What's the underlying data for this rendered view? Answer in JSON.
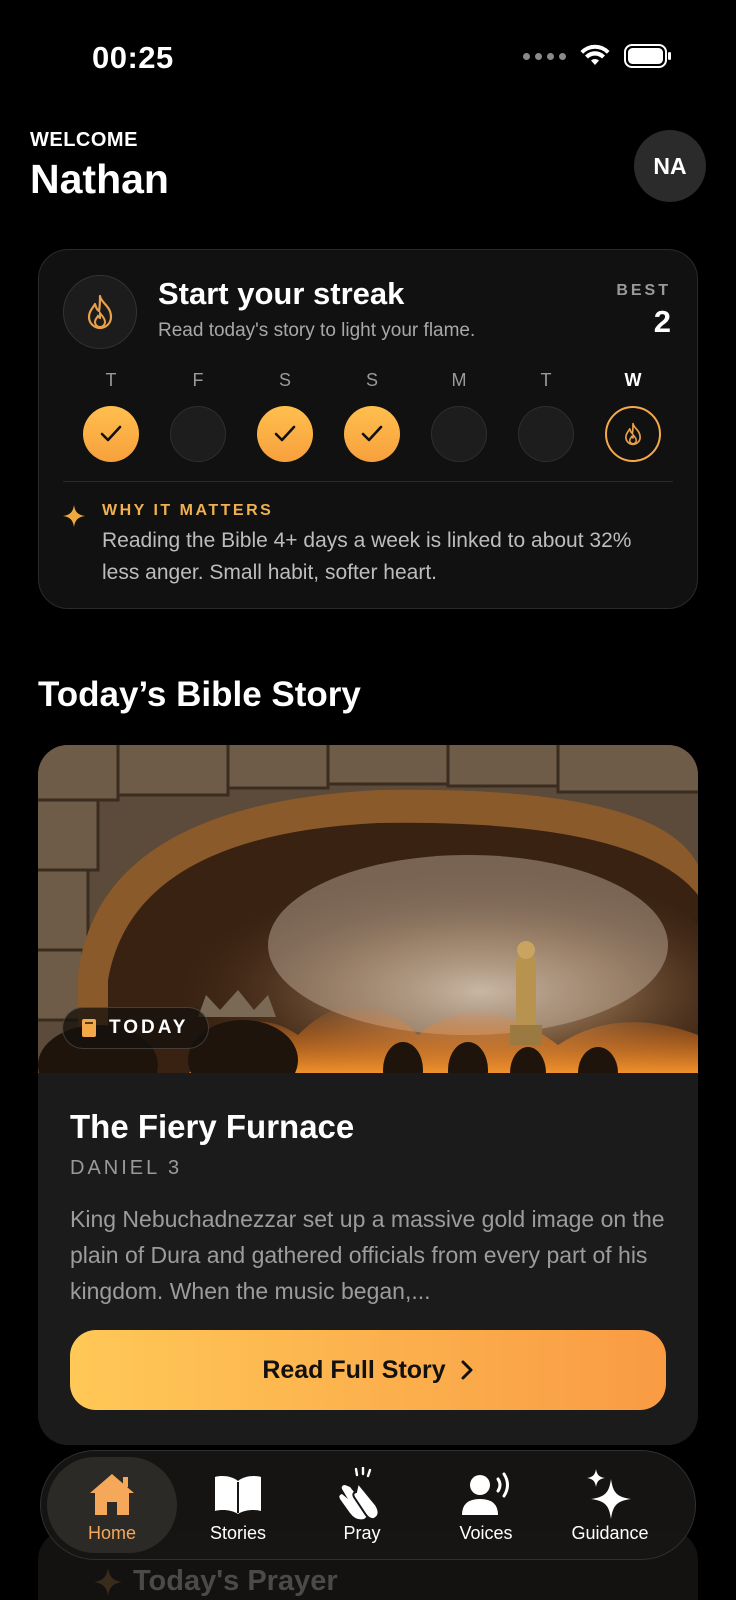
{
  "status_bar": {
    "time": "00:25"
  },
  "header": {
    "welcome_label": "WELCOME",
    "user_name": "Nathan",
    "avatar_initials": "NA"
  },
  "streak": {
    "title": "Start your streak",
    "subtitle": "Read today's story to light your flame.",
    "best_label": "BEST",
    "best_value": "2",
    "days": [
      {
        "letter": "T",
        "state": "done"
      },
      {
        "letter": "F",
        "state": "empty"
      },
      {
        "letter": "S",
        "state": "done"
      },
      {
        "letter": "S",
        "state": "done"
      },
      {
        "letter": "M",
        "state": "empty"
      },
      {
        "letter": "T",
        "state": "empty"
      },
      {
        "letter": "W",
        "state": "today"
      }
    ],
    "why_label": "WHY IT MATTERS",
    "why_text": "Reading the Bible 4+ days a week is linked to about 32% less anger. Small habit, softer heart."
  },
  "section_title": "Today’s Bible Story",
  "story": {
    "chip_label": "TODAY",
    "title": "The Fiery Furnace",
    "reference": "DANIEL 3",
    "excerpt": "King Nebuchadnezzar set up a massive gold image on the plain of Dura and gathered officials from every part of his kingdom. When the music began,...",
    "button_label": "Read Full Story"
  },
  "next_card": {
    "title": "Today's Prayer"
  },
  "tabs": [
    {
      "label": "Home",
      "icon": "home-icon",
      "active": true
    },
    {
      "label": "Stories",
      "icon": "book-icon",
      "active": false
    },
    {
      "label": "Pray",
      "icon": "praying-hands-icon",
      "active": false
    },
    {
      "label": "Voices",
      "icon": "speaking-person-icon",
      "active": false
    },
    {
      "label": "Guidance",
      "icon": "sparkles-icon",
      "active": false
    }
  ],
  "colors": {
    "accent": "#f7a33f",
    "background": "#000000",
    "card": "#111111"
  }
}
